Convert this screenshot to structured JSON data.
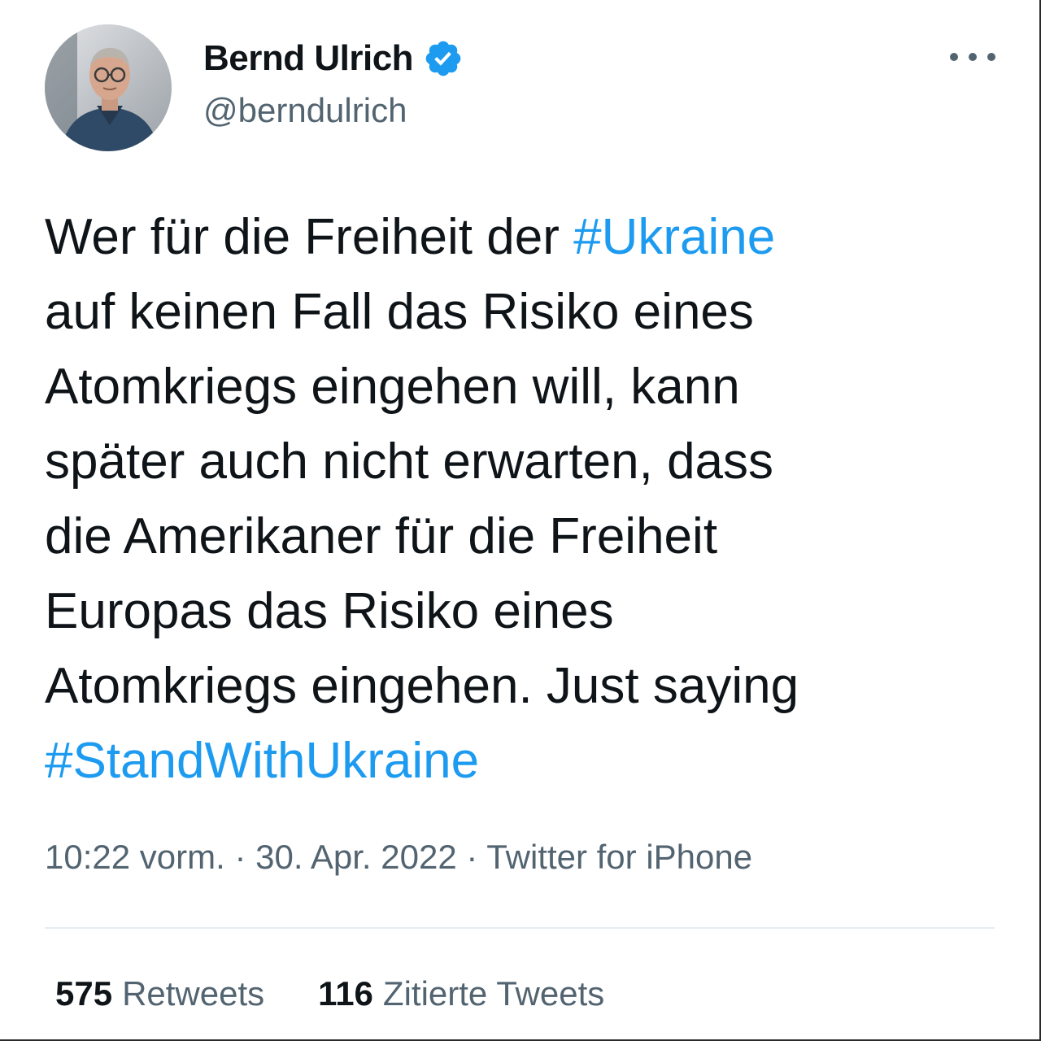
{
  "author": {
    "display_name": "Bernd Ulrich",
    "handle": "@berndulrich",
    "verified": true,
    "avatar_icon": "profile-photo-man-glasses"
  },
  "tweet": {
    "lines": [
      [
        "Wer für die Freiheit der ",
        "#Ukraine"
      ],
      [
        "auf keinen Fall das Risiko eines"
      ],
      [
        "Atomkriegs eingehen will, kann"
      ],
      [
        "später auch nicht erwarten, dass"
      ],
      [
        "die Amerikaner für die Freiheit"
      ],
      [
        "Europas das Risiko eines"
      ],
      [
        "Atomkriegs eingehen. Just saying"
      ],
      [
        "",
        "#StandWithUkraine"
      ]
    ]
  },
  "meta": {
    "time": "10:22 vorm.",
    "separator": "·",
    "date": "30. Apr. 2022",
    "source": "Twitter for iPhone"
  },
  "stats": {
    "retweets_count": "575",
    "retweets_label": "Retweets",
    "quotes_count": "116",
    "quotes_label": "Zitierte Tweets"
  },
  "colors": {
    "hashtag": "#1d9bf0",
    "verified": "#1d9bf0",
    "secondary_text": "#536471",
    "primary_text": "#0f1419"
  }
}
